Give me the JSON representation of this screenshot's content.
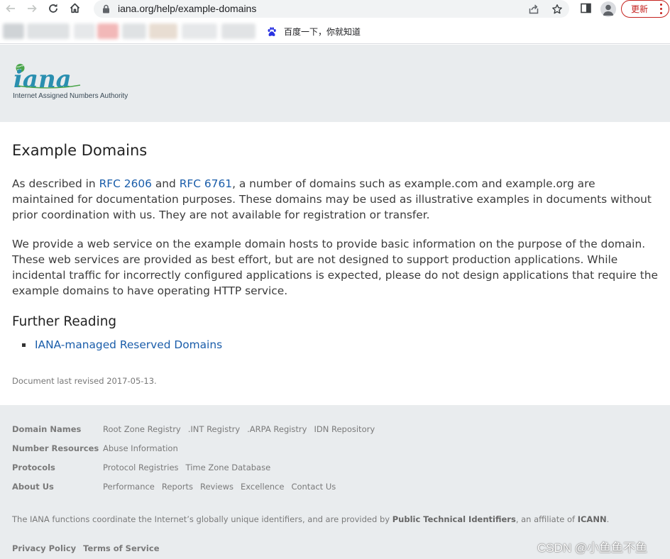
{
  "browser": {
    "url": "iana.org/help/example-domains",
    "update_label": "更新",
    "bookmark_baidu": "百度一下，你就知道"
  },
  "header": {
    "logo_text": "iana",
    "logo_subtitle": "Internet Assigned Numbers Authority"
  },
  "main": {
    "title": "Example Domains",
    "p1_before": "As described in ",
    "rfc2606": "RFC 2606",
    "p1_and": " and ",
    "rfc6761": "RFC 6761",
    "p1_after": ", a number of domains such as example.com and example.org are maintained for documentation purposes. These domains may be used as illustrative examples in documents without prior coordination with us. They are not available for registration or transfer.",
    "p2": "We provide a web service on the example domain hosts to provide basic information on the purpose of the domain. These web services are provided as best effort, but are not designed to support production applications. While incidental traffic for incorrectly configured applications is expected, please do not design applications that require the example domains to have operating HTTP service.",
    "further_reading": "Further Reading",
    "reading_link": "IANA-managed Reserved Domains",
    "revised": "Document last revised 2017-05-13."
  },
  "footer": {
    "rows": [
      {
        "heading": "Domain Names",
        "links": [
          "Root Zone Registry",
          ".INT Registry",
          ".ARPA Registry",
          "IDN Repository"
        ]
      },
      {
        "heading": "Number Resources",
        "links": [
          "Abuse Information"
        ]
      },
      {
        "heading": "Protocols",
        "links": [
          "Protocol Registries",
          "Time Zone Database"
        ]
      },
      {
        "heading": "About Us",
        "links": [
          "Performance",
          "Reports",
          "Reviews",
          "Excellence",
          "Contact Us"
        ]
      }
    ],
    "note_before": "The IANA functions coordinate the Internet’s globally unique identifiers, and are provided by ",
    "note_pti": "Public Technical Identifiers",
    "note_mid": ", an affiliate of ",
    "note_icann": "ICANN",
    "note_end": ".",
    "privacy": "Privacy Policy",
    "terms": "Terms of Service"
  },
  "watermark": "CSDN @小鱼鱼不鱼",
  "colors": {
    "link": "#1a5daa",
    "header_bg": "#e9ecee",
    "update_red": "#c5221f",
    "logo_teal": "#2a8fb0",
    "logo_green": "#4aa54a"
  }
}
